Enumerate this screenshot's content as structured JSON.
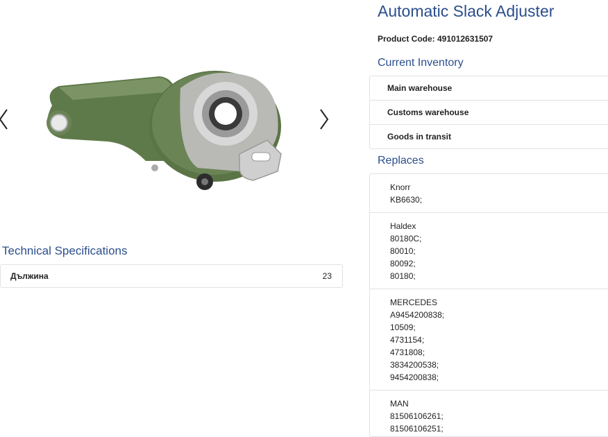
{
  "product": {
    "title": "Automatic Slack Adjuster",
    "code_label": "Product Code: 491012631507"
  },
  "gallery": {
    "prev_icon": "chevron-left-icon",
    "next_icon": "chevron-right-icon",
    "image_alt": "slack-adjuster-product-photo",
    "colors": {
      "body": "#5f7a4a",
      "ring": "#c9c9c9"
    }
  },
  "specs": {
    "title": "Technical Specifications",
    "rows": [
      {
        "name": "Дължина",
        "value": "23"
      }
    ]
  },
  "inventory": {
    "title": "Current Inventory",
    "items": [
      "Main warehouse",
      "Customs warehouse",
      "Goods in transit"
    ]
  },
  "replaces": {
    "title": "Replaces",
    "groups": [
      {
        "brand": "Knorr",
        "codes": [
          "KB6630;"
        ]
      },
      {
        "brand": "Haldex",
        "codes": [
          "80180C;",
          "80010;",
          "80092;",
          "80180;"
        ]
      },
      {
        "brand": "MERCEDES",
        "codes": [
          "A9454200838;",
          "10509;",
          "4731154;",
          "4731808;",
          "3834200538;",
          "9454200838;"
        ]
      },
      {
        "brand": "MAN",
        "codes": [
          "81506106261;",
          "81506106251;"
        ]
      }
    ]
  },
  "colors": {
    "heading": "#2b4e8c",
    "border": "#e2e2e2"
  }
}
